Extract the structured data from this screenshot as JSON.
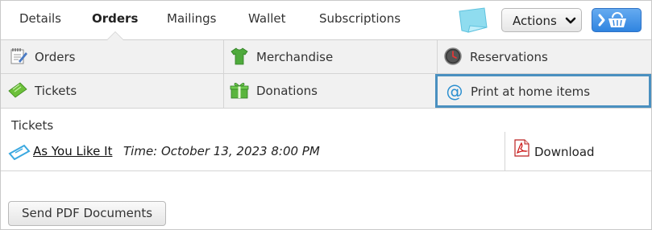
{
  "tabs": [
    {
      "label": "Details",
      "active": false
    },
    {
      "label": "Orders",
      "active": true
    },
    {
      "label": "Mailings",
      "active": false
    },
    {
      "label": "Wallet",
      "active": false
    },
    {
      "label": "Subscriptions",
      "active": false
    }
  ],
  "header": {
    "actions_label": "Actions",
    "note_icon": "sticky-note-icon",
    "cart_icon": "basket-icon",
    "accent": "#2f84e0"
  },
  "submenu": [
    {
      "label": "Orders",
      "icon": "notepad-icon"
    },
    {
      "label": "Merchandise",
      "icon": "tshirt-icon"
    },
    {
      "label": "Reservations",
      "icon": "clock-icon"
    },
    {
      "label": "Tickets",
      "icon": "ticket-icon"
    },
    {
      "label": "Donations",
      "icon": "gift-icon"
    },
    {
      "label": "Print at home items",
      "icon": "at-sign-icon",
      "selected": true
    }
  ],
  "content": {
    "section_title": "Tickets",
    "items": [
      {
        "event": "As You Like It",
        "time": "Time: October 13, 2023 8:00 PM",
        "download": "Download"
      }
    ],
    "send_button": "Send PDF Documents"
  },
  "colors": {
    "selected_border": "#4a90c0",
    "grid_bg": "#f1f1f1"
  }
}
